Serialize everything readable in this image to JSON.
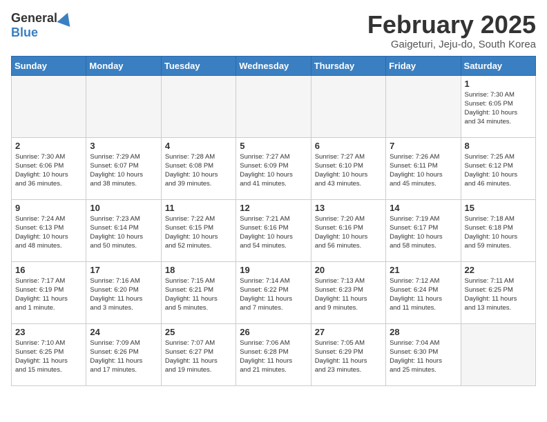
{
  "header": {
    "logo_general": "General",
    "logo_blue": "Blue",
    "month_title": "February 2025",
    "location": "Gaigeturi, Jeju-do, South Korea"
  },
  "calendar": {
    "days_of_week": [
      "Sunday",
      "Monday",
      "Tuesday",
      "Wednesday",
      "Thursday",
      "Friday",
      "Saturday"
    ],
    "weeks": [
      [
        {
          "day": "",
          "info": ""
        },
        {
          "day": "",
          "info": ""
        },
        {
          "day": "",
          "info": ""
        },
        {
          "day": "",
          "info": ""
        },
        {
          "day": "",
          "info": ""
        },
        {
          "day": "",
          "info": ""
        },
        {
          "day": "1",
          "info": "Sunrise: 7:30 AM\nSunset: 6:05 PM\nDaylight: 10 hours\nand 34 minutes."
        }
      ],
      [
        {
          "day": "2",
          "info": "Sunrise: 7:30 AM\nSunset: 6:06 PM\nDaylight: 10 hours\nand 36 minutes."
        },
        {
          "day": "3",
          "info": "Sunrise: 7:29 AM\nSunset: 6:07 PM\nDaylight: 10 hours\nand 38 minutes."
        },
        {
          "day": "4",
          "info": "Sunrise: 7:28 AM\nSunset: 6:08 PM\nDaylight: 10 hours\nand 39 minutes."
        },
        {
          "day": "5",
          "info": "Sunrise: 7:27 AM\nSunset: 6:09 PM\nDaylight: 10 hours\nand 41 minutes."
        },
        {
          "day": "6",
          "info": "Sunrise: 7:27 AM\nSunset: 6:10 PM\nDaylight: 10 hours\nand 43 minutes."
        },
        {
          "day": "7",
          "info": "Sunrise: 7:26 AM\nSunset: 6:11 PM\nDaylight: 10 hours\nand 45 minutes."
        },
        {
          "day": "8",
          "info": "Sunrise: 7:25 AM\nSunset: 6:12 PM\nDaylight: 10 hours\nand 46 minutes."
        }
      ],
      [
        {
          "day": "9",
          "info": "Sunrise: 7:24 AM\nSunset: 6:13 PM\nDaylight: 10 hours\nand 48 minutes."
        },
        {
          "day": "10",
          "info": "Sunrise: 7:23 AM\nSunset: 6:14 PM\nDaylight: 10 hours\nand 50 minutes."
        },
        {
          "day": "11",
          "info": "Sunrise: 7:22 AM\nSunset: 6:15 PM\nDaylight: 10 hours\nand 52 minutes."
        },
        {
          "day": "12",
          "info": "Sunrise: 7:21 AM\nSunset: 6:16 PM\nDaylight: 10 hours\nand 54 minutes."
        },
        {
          "day": "13",
          "info": "Sunrise: 7:20 AM\nSunset: 6:16 PM\nDaylight: 10 hours\nand 56 minutes."
        },
        {
          "day": "14",
          "info": "Sunrise: 7:19 AM\nSunset: 6:17 PM\nDaylight: 10 hours\nand 58 minutes."
        },
        {
          "day": "15",
          "info": "Sunrise: 7:18 AM\nSunset: 6:18 PM\nDaylight: 10 hours\nand 59 minutes."
        }
      ],
      [
        {
          "day": "16",
          "info": "Sunrise: 7:17 AM\nSunset: 6:19 PM\nDaylight: 11 hours\nand 1 minute."
        },
        {
          "day": "17",
          "info": "Sunrise: 7:16 AM\nSunset: 6:20 PM\nDaylight: 11 hours\nand 3 minutes."
        },
        {
          "day": "18",
          "info": "Sunrise: 7:15 AM\nSunset: 6:21 PM\nDaylight: 11 hours\nand 5 minutes."
        },
        {
          "day": "19",
          "info": "Sunrise: 7:14 AM\nSunset: 6:22 PM\nDaylight: 11 hours\nand 7 minutes."
        },
        {
          "day": "20",
          "info": "Sunrise: 7:13 AM\nSunset: 6:23 PM\nDaylight: 11 hours\nand 9 minutes."
        },
        {
          "day": "21",
          "info": "Sunrise: 7:12 AM\nSunset: 6:24 PM\nDaylight: 11 hours\nand 11 minutes."
        },
        {
          "day": "22",
          "info": "Sunrise: 7:11 AM\nSunset: 6:25 PM\nDaylight: 11 hours\nand 13 minutes."
        }
      ],
      [
        {
          "day": "23",
          "info": "Sunrise: 7:10 AM\nSunset: 6:25 PM\nDaylight: 11 hours\nand 15 minutes."
        },
        {
          "day": "24",
          "info": "Sunrise: 7:09 AM\nSunset: 6:26 PM\nDaylight: 11 hours\nand 17 minutes."
        },
        {
          "day": "25",
          "info": "Sunrise: 7:07 AM\nSunset: 6:27 PM\nDaylight: 11 hours\nand 19 minutes."
        },
        {
          "day": "26",
          "info": "Sunrise: 7:06 AM\nSunset: 6:28 PM\nDaylight: 11 hours\nand 21 minutes."
        },
        {
          "day": "27",
          "info": "Sunrise: 7:05 AM\nSunset: 6:29 PM\nDaylight: 11 hours\nand 23 minutes."
        },
        {
          "day": "28",
          "info": "Sunrise: 7:04 AM\nSunset: 6:30 PM\nDaylight: 11 hours\nand 25 minutes."
        },
        {
          "day": "",
          "info": ""
        }
      ]
    ]
  }
}
